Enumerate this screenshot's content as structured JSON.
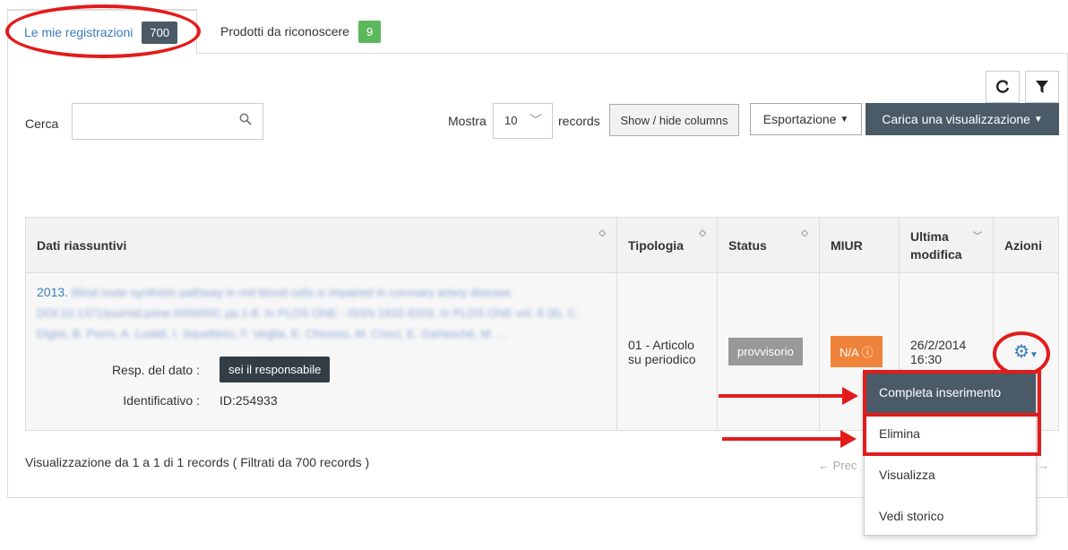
{
  "tabs": [
    {
      "label": "Le mie registrazioni",
      "count": "700"
    },
    {
      "label": "Prodotti da riconoscere",
      "count": "9"
    }
  ],
  "toolbar": {
    "search_label": "Cerca",
    "search_placeholder": "",
    "show_label": "Mostra",
    "page_size": "10",
    "records_label": "records",
    "show_hide_columns": "Show / hide columns",
    "export_label": "Esportazione",
    "load_view_label": "Carica una visualizzazione",
    "refresh_icon": "refresh-icon",
    "filter_icon": "filter-icon"
  },
  "table": {
    "headers": [
      "Dati riassuntivi",
      "Tipologia",
      "Status",
      "MIUR",
      "Ultima modifica",
      "Azioni"
    ],
    "rows": [
      {
        "year": "2013.",
        "summary_blurred": "Blind route synthetic pathway in red blood cells is impaired in coronary artery disease. DOI:10.1371/journal.pone.0000000; pp.1-8. In PLOS ONE - ISSN 1932-6203. In PLOS ONE vol. 8 (8). C. Digini, B. Porro, A. Lualdi, I. Squellerio, F. Veglia, E. Chiorino, M. Crisci, E. Garlaschè, M. ...",
        "resp_label": "Resp. del dato :",
        "resp_value": "sei il responsabile",
        "id_label": "Identificativo :",
        "id_value": "ID:254933",
        "tipologia": "01 - Articolo su periodico",
        "status": "provvisorio",
        "miur": "N/A",
        "modified_date": "26/2/2014",
        "modified_time": "16:30"
      }
    ]
  },
  "footer": {
    "info": "Visualizzazione da 1 a 1 di 1 records ( Filtrati da 700 records )",
    "prev": "← Prec",
    "next": "→"
  },
  "actions_menu": [
    "Completa inserimento",
    "Elimina",
    "Visualizza",
    "Vedi storico"
  ],
  "colors": {
    "annotation_red": "#e31b1b",
    "dark": "#4a5a66",
    "link": "#3a7bbf",
    "badge_green": "#5cb85c",
    "miur_orange": "#f0833a"
  }
}
